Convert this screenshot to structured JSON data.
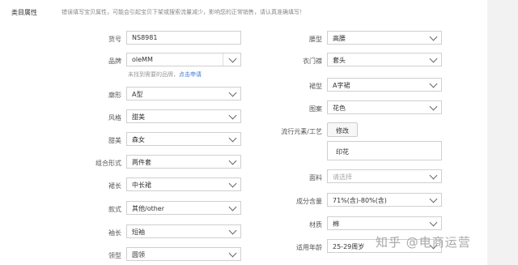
{
  "section": {
    "title": "类目属性",
    "hint": "错误填写宝贝属性，可能会引起宝贝下架或搜索流量减少，影响您的正常销售，请认真准确填写！"
  },
  "left_fields": [
    {
      "label": "货号",
      "value": "NS8981",
      "type": "text"
    },
    {
      "label": "品牌",
      "value": "oleMM",
      "type": "combo"
    },
    {
      "label": "廓形",
      "value": "A型",
      "type": "select"
    },
    {
      "label": "风格",
      "value": "甜美",
      "type": "select"
    },
    {
      "label": "甜美",
      "value": "森女",
      "type": "select"
    },
    {
      "label": "组合形式",
      "value": "两件套",
      "type": "select"
    },
    {
      "label": "裙长",
      "value": "中长裙",
      "type": "select"
    },
    {
      "label": "款式",
      "value": "其他/other",
      "type": "select"
    },
    {
      "label": "袖长",
      "value": "短袖",
      "type": "select"
    },
    {
      "label": "领型",
      "value": "圆领",
      "type": "select"
    }
  ],
  "brand_hint": {
    "text": "未找到需要的品牌，",
    "link": "点击申请"
  },
  "right_fields": [
    {
      "label": "腰型",
      "value": "高腰",
      "type": "select"
    },
    {
      "label": "衣门襟",
      "value": "套头",
      "type": "select"
    },
    {
      "label": "裙型",
      "value": "A字裙",
      "type": "select"
    },
    {
      "label": "图案",
      "value": "花色",
      "type": "select"
    },
    {
      "label": "流行元素/工艺",
      "button": "修改",
      "textarea": "印花"
    },
    {
      "label": "面料",
      "value": "请选择",
      "type": "select",
      "placeholder": true
    },
    {
      "label": "成分含量",
      "value": "71%(含)-80%(含)",
      "type": "select"
    },
    {
      "label": "材质",
      "value": "棉",
      "type": "select"
    },
    {
      "label": "适用年龄",
      "value": "25-29周岁",
      "type": "select"
    }
  ],
  "watermark": "知乎 @电商运营"
}
